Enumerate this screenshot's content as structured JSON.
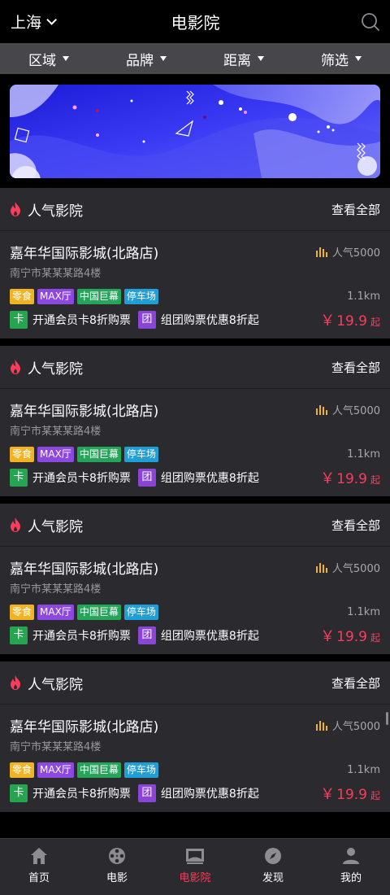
{
  "header": {
    "city": "上海",
    "title": "电影院"
  },
  "filters": [
    {
      "label": "区域"
    },
    {
      "label": "品牌"
    },
    {
      "label": "距离"
    },
    {
      "label": "筛选"
    }
  ],
  "sections": [
    {
      "title": "人气影院",
      "view_all": "查看全部",
      "cinema": {
        "name": "嘉年华国际影城(北路店)",
        "popularity": "人气5000",
        "address": "南宁市某某某路4楼",
        "tags": [
          "零食",
          "MAX厅",
          "中国巨幕",
          "停车场"
        ],
        "distance": "1.1km",
        "promo_card_badge": "卡",
        "promo_card_text": "开通会员卡8折购票",
        "promo_group_badge": "团",
        "promo_group_text": "组团购票优惠8折起",
        "price_symbol": "￥",
        "price": "19.9",
        "price_suffix": "起"
      }
    },
    {
      "title": "人气影院",
      "view_all": "查看全部",
      "cinema": {
        "name": "嘉年华国际影城(北路店)",
        "popularity": "人气5000",
        "address": "南宁市某某某路4楼",
        "tags": [
          "零食",
          "MAX厅",
          "中国巨幕",
          "停车场"
        ],
        "distance": "1.1km",
        "promo_card_badge": "卡",
        "promo_card_text": "开通会员卡8折购票",
        "promo_group_badge": "团",
        "promo_group_text": "组团购票优惠8折起",
        "price_symbol": "￥",
        "price": "19.9",
        "price_suffix": "起"
      }
    },
    {
      "title": "人气影院",
      "view_all": "查看全部",
      "cinema": {
        "name": "嘉年华国际影城(北路店)",
        "popularity": "人气5000",
        "address": "南宁市某某某路4楼",
        "tags": [
          "零食",
          "MAX厅",
          "中国巨幕",
          "停车场"
        ],
        "distance": "1.1km",
        "promo_card_badge": "卡",
        "promo_card_text": "开通会员卡8折购票",
        "promo_group_badge": "团",
        "promo_group_text": "组团购票优惠8折起",
        "price_symbol": "￥",
        "price": "19.9",
        "price_suffix": "起"
      }
    },
    {
      "title": "人气影院",
      "view_all": "查看全部",
      "cinema": {
        "name": "嘉年华国际影城(北路店)",
        "popularity": "人气5000",
        "address": "南宁市某某某路4楼",
        "tags": [
          "零食",
          "MAX厅",
          "中国巨幕",
          "停车场"
        ],
        "distance": "1.1km",
        "promo_card_badge": "卡",
        "promo_card_text": "开通会员卡8折购票",
        "promo_group_badge": "团",
        "promo_group_text": "组团购票优惠8折起",
        "price_symbol": "￥",
        "price": "19.9",
        "price_suffix": "起"
      }
    }
  ],
  "bottom_nav": [
    {
      "label": "首页",
      "icon": "home-icon"
    },
    {
      "label": "电影",
      "icon": "film-reel-icon"
    },
    {
      "label": "电影院",
      "icon": "cinema-screen-icon",
      "active": true
    },
    {
      "label": "发现",
      "icon": "compass-icon"
    },
    {
      "label": "我的",
      "icon": "user-icon"
    }
  ],
  "colors": {
    "accent": "#ff3b5c",
    "background": "#000000",
    "card": "#2b2a2f",
    "filter_bar": "#47464b",
    "popularity_icon": "#f0b323"
  }
}
